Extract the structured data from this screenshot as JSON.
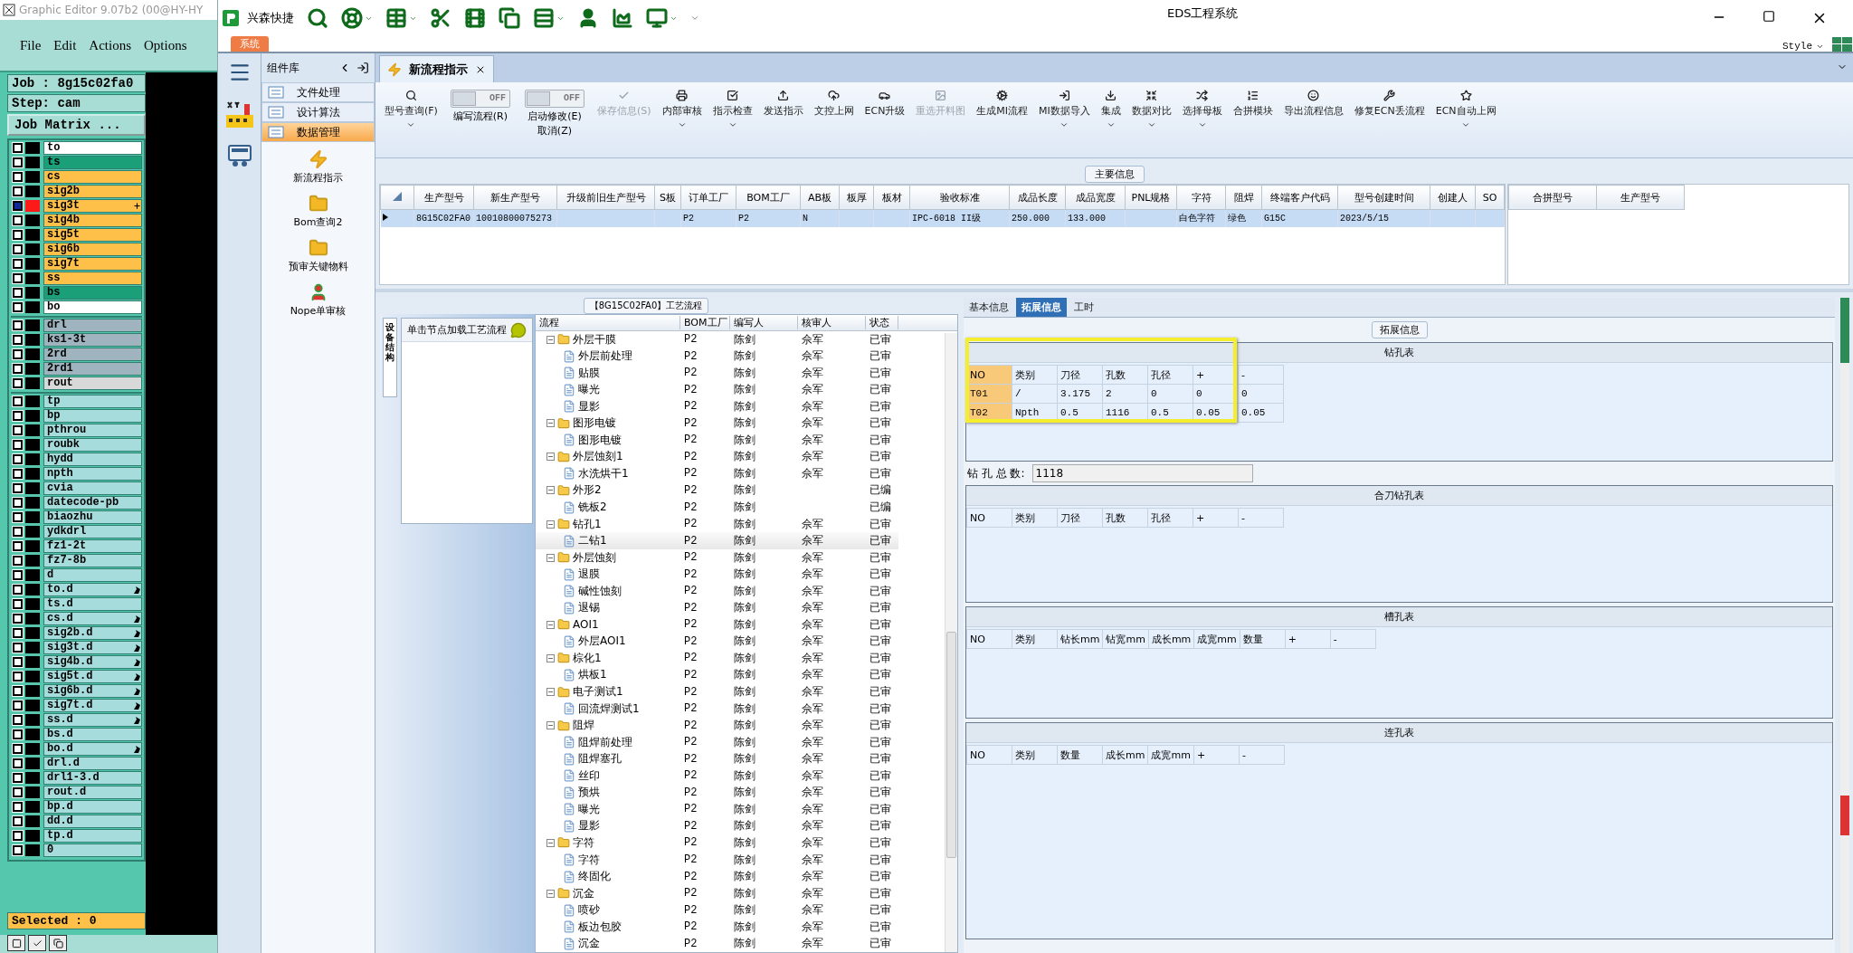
{
  "editor": {
    "title": "Graphic Editor 9.07b2 (00@HY-HY",
    "menu": [
      "File",
      "Edit",
      "Actions",
      "Options"
    ],
    "job": "Job : 8g15c02fa0",
    "step": "Step: cam",
    "matrix_button": "Job Matrix ...",
    "layer_groups": [
      [
        {
          "name": "to",
          "color": "#ffffff",
          "selected": false,
          "flagged": false
        },
        {
          "name": "ts",
          "color": "#1a9f78",
          "selected": false,
          "flagged": false
        },
        {
          "name": "cs",
          "color": "#ffc04a",
          "selected": false,
          "flagged": false
        },
        {
          "name": "sig2b",
          "color": "#ffc04a",
          "selected": false,
          "flagged": false
        },
        {
          "name": "sig3t",
          "color": "#ffc04a",
          "selected": true,
          "flagged": false
        },
        {
          "name": "sig4b",
          "color": "#ffc04a",
          "selected": false,
          "flagged": false
        },
        {
          "name": "sig5t",
          "color": "#ffc04a",
          "selected": false,
          "flagged": false
        },
        {
          "name": "sig6b",
          "color": "#ffc04a",
          "selected": false,
          "flagged": false
        },
        {
          "name": "sig7t",
          "color": "#ffc04a",
          "selected": false,
          "flagged": false
        },
        {
          "name": "ss",
          "color": "#ffc04a",
          "selected": false,
          "flagged": false
        },
        {
          "name": "bs",
          "color": "#1a9f78",
          "selected": false,
          "flagged": false
        },
        {
          "name": "bo",
          "color": "#ffffff",
          "selected": false,
          "flagged": false
        }
      ],
      [
        {
          "name": "drl",
          "color": "#9fb4be",
          "selected": false,
          "flagged": false
        },
        {
          "name": "ks1-3t",
          "color": "#9fb4be",
          "selected": false,
          "flagged": false
        },
        {
          "name": "2rd",
          "color": "#9fb4be",
          "selected": false,
          "flagged": false
        },
        {
          "name": "2rd1",
          "color": "#9fb4be",
          "selected": false,
          "flagged": false
        },
        {
          "name": "rout",
          "color": "#d9d9d9",
          "selected": false,
          "flagged": false
        }
      ],
      [
        {
          "name": "tp",
          "color": "#a6dcdc",
          "selected": false,
          "flagged": false
        },
        {
          "name": "bp",
          "color": "#a6dcdc",
          "selected": false,
          "flagged": false
        },
        {
          "name": "pthrou",
          "color": "#a6dcdc",
          "selected": false,
          "flagged": false
        },
        {
          "name": "roubk",
          "color": "#a6dcdc",
          "selected": false,
          "flagged": false
        },
        {
          "name": "hydd",
          "color": "#a6dcdc",
          "selected": false,
          "flagged": false
        },
        {
          "name": "npth",
          "color": "#a6dcdc",
          "selected": false,
          "flagged": false
        },
        {
          "name": "cvia",
          "color": "#a6dcdc",
          "selected": false,
          "flagged": false
        },
        {
          "name": "datecode-pb",
          "color": "#a6dcdc",
          "selected": false,
          "flagged": false
        },
        {
          "name": "biaozhu",
          "color": "#a6dcdc",
          "selected": false,
          "flagged": false
        },
        {
          "name": "ydkdrl",
          "color": "#a6dcdc",
          "selected": false,
          "flagged": false
        },
        {
          "name": "fz1-2t",
          "color": "#a6dcdc",
          "selected": false,
          "flagged": false
        },
        {
          "name": "fz7-8b",
          "color": "#a6dcdc",
          "selected": false,
          "flagged": false
        },
        {
          "name": "d",
          "color": "#a6dcdc",
          "selected": false,
          "flagged": false
        },
        {
          "name": "to.d",
          "color": "#a6dcdc",
          "selected": false,
          "flagged": true
        },
        {
          "name": "ts.d",
          "color": "#a6dcdc",
          "selected": false,
          "flagged": false
        },
        {
          "name": "cs.d",
          "color": "#a6dcdc",
          "selected": false,
          "flagged": true
        },
        {
          "name": "sig2b.d",
          "color": "#a6dcdc",
          "selected": false,
          "flagged": true
        },
        {
          "name": "sig3t.d",
          "color": "#a6dcdc",
          "selected": false,
          "flagged": true
        },
        {
          "name": "sig4b.d",
          "color": "#a6dcdc",
          "selected": false,
          "flagged": true
        },
        {
          "name": "sig5t.d",
          "color": "#a6dcdc",
          "selected": false,
          "flagged": true
        },
        {
          "name": "sig6b.d",
          "color": "#a6dcdc",
          "selected": false,
          "flagged": true
        },
        {
          "name": "sig7t.d",
          "color": "#a6dcdc",
          "selected": false,
          "flagged": true
        },
        {
          "name": "ss.d",
          "color": "#a6dcdc",
          "selected": false,
          "flagged": true
        },
        {
          "name": "bs.d",
          "color": "#a6dcdc",
          "selected": false,
          "flagged": false
        },
        {
          "name": "bo.d",
          "color": "#a6dcdc",
          "selected": false,
          "flagged": true
        },
        {
          "name": "drl.d",
          "color": "#a6dcdc",
          "selected": false,
          "flagged": false
        },
        {
          "name": "drl1-3.d",
          "color": "#a6dcdc",
          "selected": false,
          "flagged": false
        },
        {
          "name": "rout.d",
          "color": "#a6dcdc",
          "selected": false,
          "flagged": false
        },
        {
          "name": "bp.d",
          "color": "#a6dcdc",
          "selected": false,
          "flagged": false
        },
        {
          "name": "dd.d",
          "color": "#a6dcdc",
          "selected": false,
          "flagged": false
        },
        {
          "name": "tp.d",
          "color": "#a6dcdc",
          "selected": false,
          "flagged": false
        },
        {
          "name": "0",
          "color": "#a6dcdc",
          "selected": false,
          "flagged": false
        }
      ]
    ],
    "status": "Selected : 0"
  },
  "window": {
    "brand": "兴森快捷",
    "title": "EDS工程系统",
    "system_tab": "系统",
    "style_menu": "Style"
  },
  "component_library": {
    "title": "组件库",
    "categories": [
      {
        "label": "文件处理",
        "selected": false
      },
      {
        "label": "设计算法",
        "selected": false
      },
      {
        "label": "数据管理",
        "selected": true
      }
    ],
    "items": [
      "新流程指示",
      "Bom查询2",
      "预审关键物料",
      "Nope单审核"
    ]
  },
  "document_tab": {
    "label": "新流程指示"
  },
  "toolbar": [
    {
      "kind": "button",
      "label": "型号查询(F)",
      "dropdown": true,
      "disabled": false
    },
    {
      "kind": "toggle",
      "label": "编写流程(R)",
      "state_text": "OFF",
      "on": false
    },
    {
      "kind": "toggle",
      "label": "启动修改(E)\n取消(Z)",
      "state_text": "OFF",
      "on": false
    },
    {
      "kind": "button",
      "label": "保存信息(S)",
      "dropdown": false,
      "disabled": true
    },
    {
      "kind": "button",
      "label": "内部审核",
      "dropdown": true,
      "disabled": false
    },
    {
      "kind": "button",
      "label": "指示检查",
      "dropdown": true,
      "disabled": false
    },
    {
      "kind": "button",
      "label": "发送指示",
      "dropdown": false,
      "disabled": false
    },
    {
      "kind": "button",
      "label": "文控上网",
      "dropdown": false,
      "disabled": false
    },
    {
      "kind": "button",
      "label": "ECN升级",
      "dropdown": false,
      "disabled": false
    },
    {
      "kind": "button",
      "label": "重选开料图",
      "dropdown": false,
      "disabled": true
    },
    {
      "kind": "button",
      "label": "生成MI流程",
      "dropdown": false,
      "disabled": false
    },
    {
      "kind": "button",
      "label": "MI数据导入",
      "dropdown": true,
      "disabled": false
    },
    {
      "kind": "button",
      "label": "集成",
      "dropdown": true,
      "disabled": false
    },
    {
      "kind": "button",
      "label": "数据对比",
      "dropdown": true,
      "disabled": false
    },
    {
      "kind": "button",
      "label": "选择母板",
      "dropdown": true,
      "disabled": false
    },
    {
      "kind": "button",
      "label": "合拼模块",
      "dropdown": false,
      "disabled": false
    },
    {
      "kind": "button",
      "label": "导出流程信息",
      "dropdown": false,
      "disabled": false
    },
    {
      "kind": "button",
      "label": "修复ECN丢流程",
      "dropdown": false,
      "disabled": false
    },
    {
      "kind": "button",
      "label": "ECN自动上网",
      "dropdown": true,
      "disabled": false
    }
  ],
  "main_info": {
    "title": "主要信息",
    "columns": [
      "生产型号",
      "新生产型号",
      "升级前旧生产型号",
      "S板",
      "订单工厂",
      "BOM工厂",
      "AB板",
      "板厚",
      "板材",
      "验收标准",
      "成品长度",
      "成品宽度",
      "PNL规格",
      "字符",
      "阻焊",
      "终端客户代码",
      "型号创建时间",
      "创建人",
      "SO"
    ],
    "rows": [
      {
        "selected": true,
        "cells": [
          "8G15C02FA0",
          "10010800075273",
          "",
          "",
          "P2",
          "P2",
          "N",
          "",
          "",
          "IPC-6018 II级",
          "250.000",
          "133.000",
          "",
          "白色字符",
          "绿色",
          "G15C",
          "2023/5/15",
          "",
          ""
        ]
      }
    ],
    "side_columns": [
      "合拼型号",
      "生产型号"
    ]
  },
  "process_panel": {
    "title": "【8G15C02FA0】工艺流程",
    "side_tab": "设备结构",
    "hint": "单击节点加载工艺流程"
  },
  "process_tree": {
    "columns": [
      "流程",
      "BOM工厂",
      "编写人",
      "核审人",
      "状态"
    ],
    "nodes": [
      {
        "name": "外层干膜",
        "bom": "P2",
        "author": "陈剑",
        "reviewer": "佘军",
        "status": "已审",
        "selected": false,
        "children": [
          {
            "name": "外层前处理",
            "bom": "P2",
            "author": "陈剑",
            "reviewer": "佘军",
            "status": "已审",
            "selected": false
          },
          {
            "name": "贴膜",
            "bom": "P2",
            "author": "陈剑",
            "reviewer": "佘军",
            "status": "已审",
            "selected": false
          },
          {
            "name": "曝光",
            "bom": "P2",
            "author": "陈剑",
            "reviewer": "佘军",
            "status": "已审",
            "selected": false
          },
          {
            "name": "显影",
            "bom": "P2",
            "author": "陈剑",
            "reviewer": "佘军",
            "status": "已审",
            "selected": false
          }
        ]
      },
      {
        "name": "图形电镀",
        "bom": "P2",
        "author": "陈剑",
        "reviewer": "佘军",
        "status": "已审",
        "selected": false,
        "children": [
          {
            "name": "图形电镀",
            "bom": "P2",
            "author": "陈剑",
            "reviewer": "佘军",
            "status": "已审",
            "selected": false
          }
        ]
      },
      {
        "name": "外层蚀刻1",
        "bom": "P2",
        "author": "陈剑",
        "reviewer": "佘军",
        "status": "已审",
        "selected": false,
        "children": [
          {
            "name": "水洗烘干1",
            "bom": "P2",
            "author": "陈剑",
            "reviewer": "佘军",
            "status": "已审",
            "selected": false
          }
        ]
      },
      {
        "name": "外形2",
        "bom": "P2",
        "author": "陈剑",
        "status": "已编",
        "selected": false,
        "children": [
          {
            "name": "铣板2",
            "bom": "P2",
            "author": "陈剑",
            "status": "已编",
            "selected": false
          }
        ]
      },
      {
        "name": "钻孔1",
        "bom": "P2",
        "author": "陈剑",
        "reviewer": "佘军",
        "status": "已审",
        "selected": false,
        "children": [
          {
            "name": "二钻1",
            "bom": "P2",
            "author": "陈剑",
            "reviewer": "佘军",
            "status": "已审",
            "selected": true
          }
        ]
      },
      {
        "name": "外层蚀刻",
        "bom": "P2",
        "author": "陈剑",
        "reviewer": "佘军",
        "status": "已审",
        "selected": false,
        "children": [
          {
            "name": "退膜",
            "bom": "P2",
            "author": "陈剑",
            "reviewer": "佘军",
            "status": "已审",
            "selected": false
          },
          {
            "name": "碱性蚀刻",
            "bom": "P2",
            "author": "陈剑",
            "reviewer": "佘军",
            "status": "已审",
            "selected": false
          },
          {
            "name": "退锡",
            "bom": "P2",
            "author": "陈剑",
            "reviewer": "佘军",
            "status": "已审",
            "selected": false
          }
        ]
      },
      {
        "name": "AOI1",
        "bom": "P2",
        "author": "陈剑",
        "reviewer": "佘军",
        "status": "已审",
        "selected": false,
        "children": [
          {
            "name": "外层AOI1",
            "bom": "P2",
            "author": "陈剑",
            "reviewer": "佘军",
            "status": "已审",
            "selected": false
          }
        ]
      },
      {
        "name": "棕化1",
        "bom": "P2",
        "author": "陈剑",
        "reviewer": "佘军",
        "status": "已审",
        "selected": false,
        "children": [
          {
            "name": "烘板1",
            "bom": "P2",
            "author": "陈剑",
            "reviewer": "佘军",
            "status": "已审",
            "selected": false
          }
        ]
      },
      {
        "name": "电子测试1",
        "bom": "P2",
        "author": "陈剑",
        "reviewer": "佘军",
        "status": "已审",
        "selected": false,
        "children": [
          {
            "name": "回流焊测试1",
            "bom": "P2",
            "author": "陈剑",
            "reviewer": "佘军",
            "status": "已审",
            "selected": false
          }
        ]
      },
      {
        "name": "阻焊",
        "bom": "P2",
        "author": "陈剑",
        "reviewer": "佘军",
        "status": "已审",
        "selected": false,
        "children": [
          {
            "name": "阻焊前处理",
            "bom": "P2",
            "author": "陈剑",
            "reviewer": "佘军",
            "status": "已审",
            "selected": false
          },
          {
            "name": "阻焊塞孔",
            "bom": "P2",
            "author": "陈剑",
            "reviewer": "佘军",
            "status": "已审",
            "selected": false
          },
          {
            "name": "丝印",
            "bom": "P2",
            "author": "陈剑",
            "reviewer": "佘军",
            "status": "已审",
            "selected": false
          },
          {
            "name": "预烘",
            "bom": "P2",
            "author": "陈剑",
            "reviewer": "佘军",
            "status": "已审",
            "selected": false
          },
          {
            "name": "曝光",
            "bom": "P2",
            "author": "陈剑",
            "reviewer": "佘军",
            "status": "已审",
            "selected": false
          },
          {
            "name": "显影",
            "bom": "P2",
            "author": "陈剑",
            "reviewer": "佘军",
            "status": "已审",
            "selected": false
          }
        ]
      },
      {
        "name": "字符",
        "bom": "P2",
        "author": "陈剑",
        "reviewer": "佘军",
        "status": "已审",
        "selected": false,
        "children": [
          {
            "name": "字符",
            "bom": "P2",
            "author": "陈剑",
            "reviewer": "佘军",
            "status": "已审",
            "selected": false
          },
          {
            "name": "终固化",
            "bom": "P2",
            "author": "陈剑",
            "reviewer": "佘军",
            "status": "已审",
            "selected": false
          }
        ]
      },
      {
        "name": "沉金",
        "bom": "P2",
        "author": "陈剑",
        "reviewer": "佘军",
        "status": "已审",
        "selected": false,
        "children": [
          {
            "name": "喷砂",
            "bom": "P2",
            "author": "陈剑",
            "reviewer": "佘军",
            "status": "已审",
            "selected": false
          },
          {
            "name": "板边包胶",
            "bom": "P2",
            "author": "陈剑",
            "reviewer": "佘军",
            "status": "已审",
            "selected": false
          },
          {
            "name": "沉金",
            "bom": "P2",
            "author": "陈剑",
            "reviewer": "佘军",
            "status": "已审",
            "selected": false
          }
        ]
      }
    ]
  },
  "detail": {
    "tabs": [
      {
        "label": "基本信息",
        "selected": false
      },
      {
        "label": "拓展信息",
        "selected": true
      },
      {
        "label": "工时",
        "selected": false
      }
    ],
    "group_title": "拓展信息",
    "sections": [
      {
        "title": "钻孔表",
        "highlighted": true,
        "columns": [
          "NO",
          "类别",
          "刀径",
          "孔数",
          "孔径",
          "+",
          "-"
        ],
        "rows": [
          [
            "T01",
            "/",
            "3.175",
            "2",
            "0",
            "0",
            "0"
          ],
          [
            "T02",
            "Npth",
            "0.5",
            "1116",
            "0.5",
            "0.05",
            "0.05"
          ]
        ]
      },
      {
        "title": "合刀钻孔表",
        "highlighted": false,
        "columns": [
          "NO",
          "类别",
          "刀径",
          "孔数",
          "孔径",
          "+",
          "-"
        ]
      },
      {
        "title": "槽孔表",
        "highlighted": false,
        "columns": [
          "NO",
          "类别",
          "钻长mm",
          "钻宽mm",
          "成长mm",
          "成宽mm",
          "数量",
          "+",
          "-"
        ]
      },
      {
        "title": "连孔表",
        "highlighted": false,
        "columns": [
          "NO",
          "类别",
          "数量",
          "成长mm",
          "成宽mm",
          "+",
          "-"
        ]
      }
    ],
    "total_label": "钻 孔 总 数:",
    "total_value": "1118"
  }
}
